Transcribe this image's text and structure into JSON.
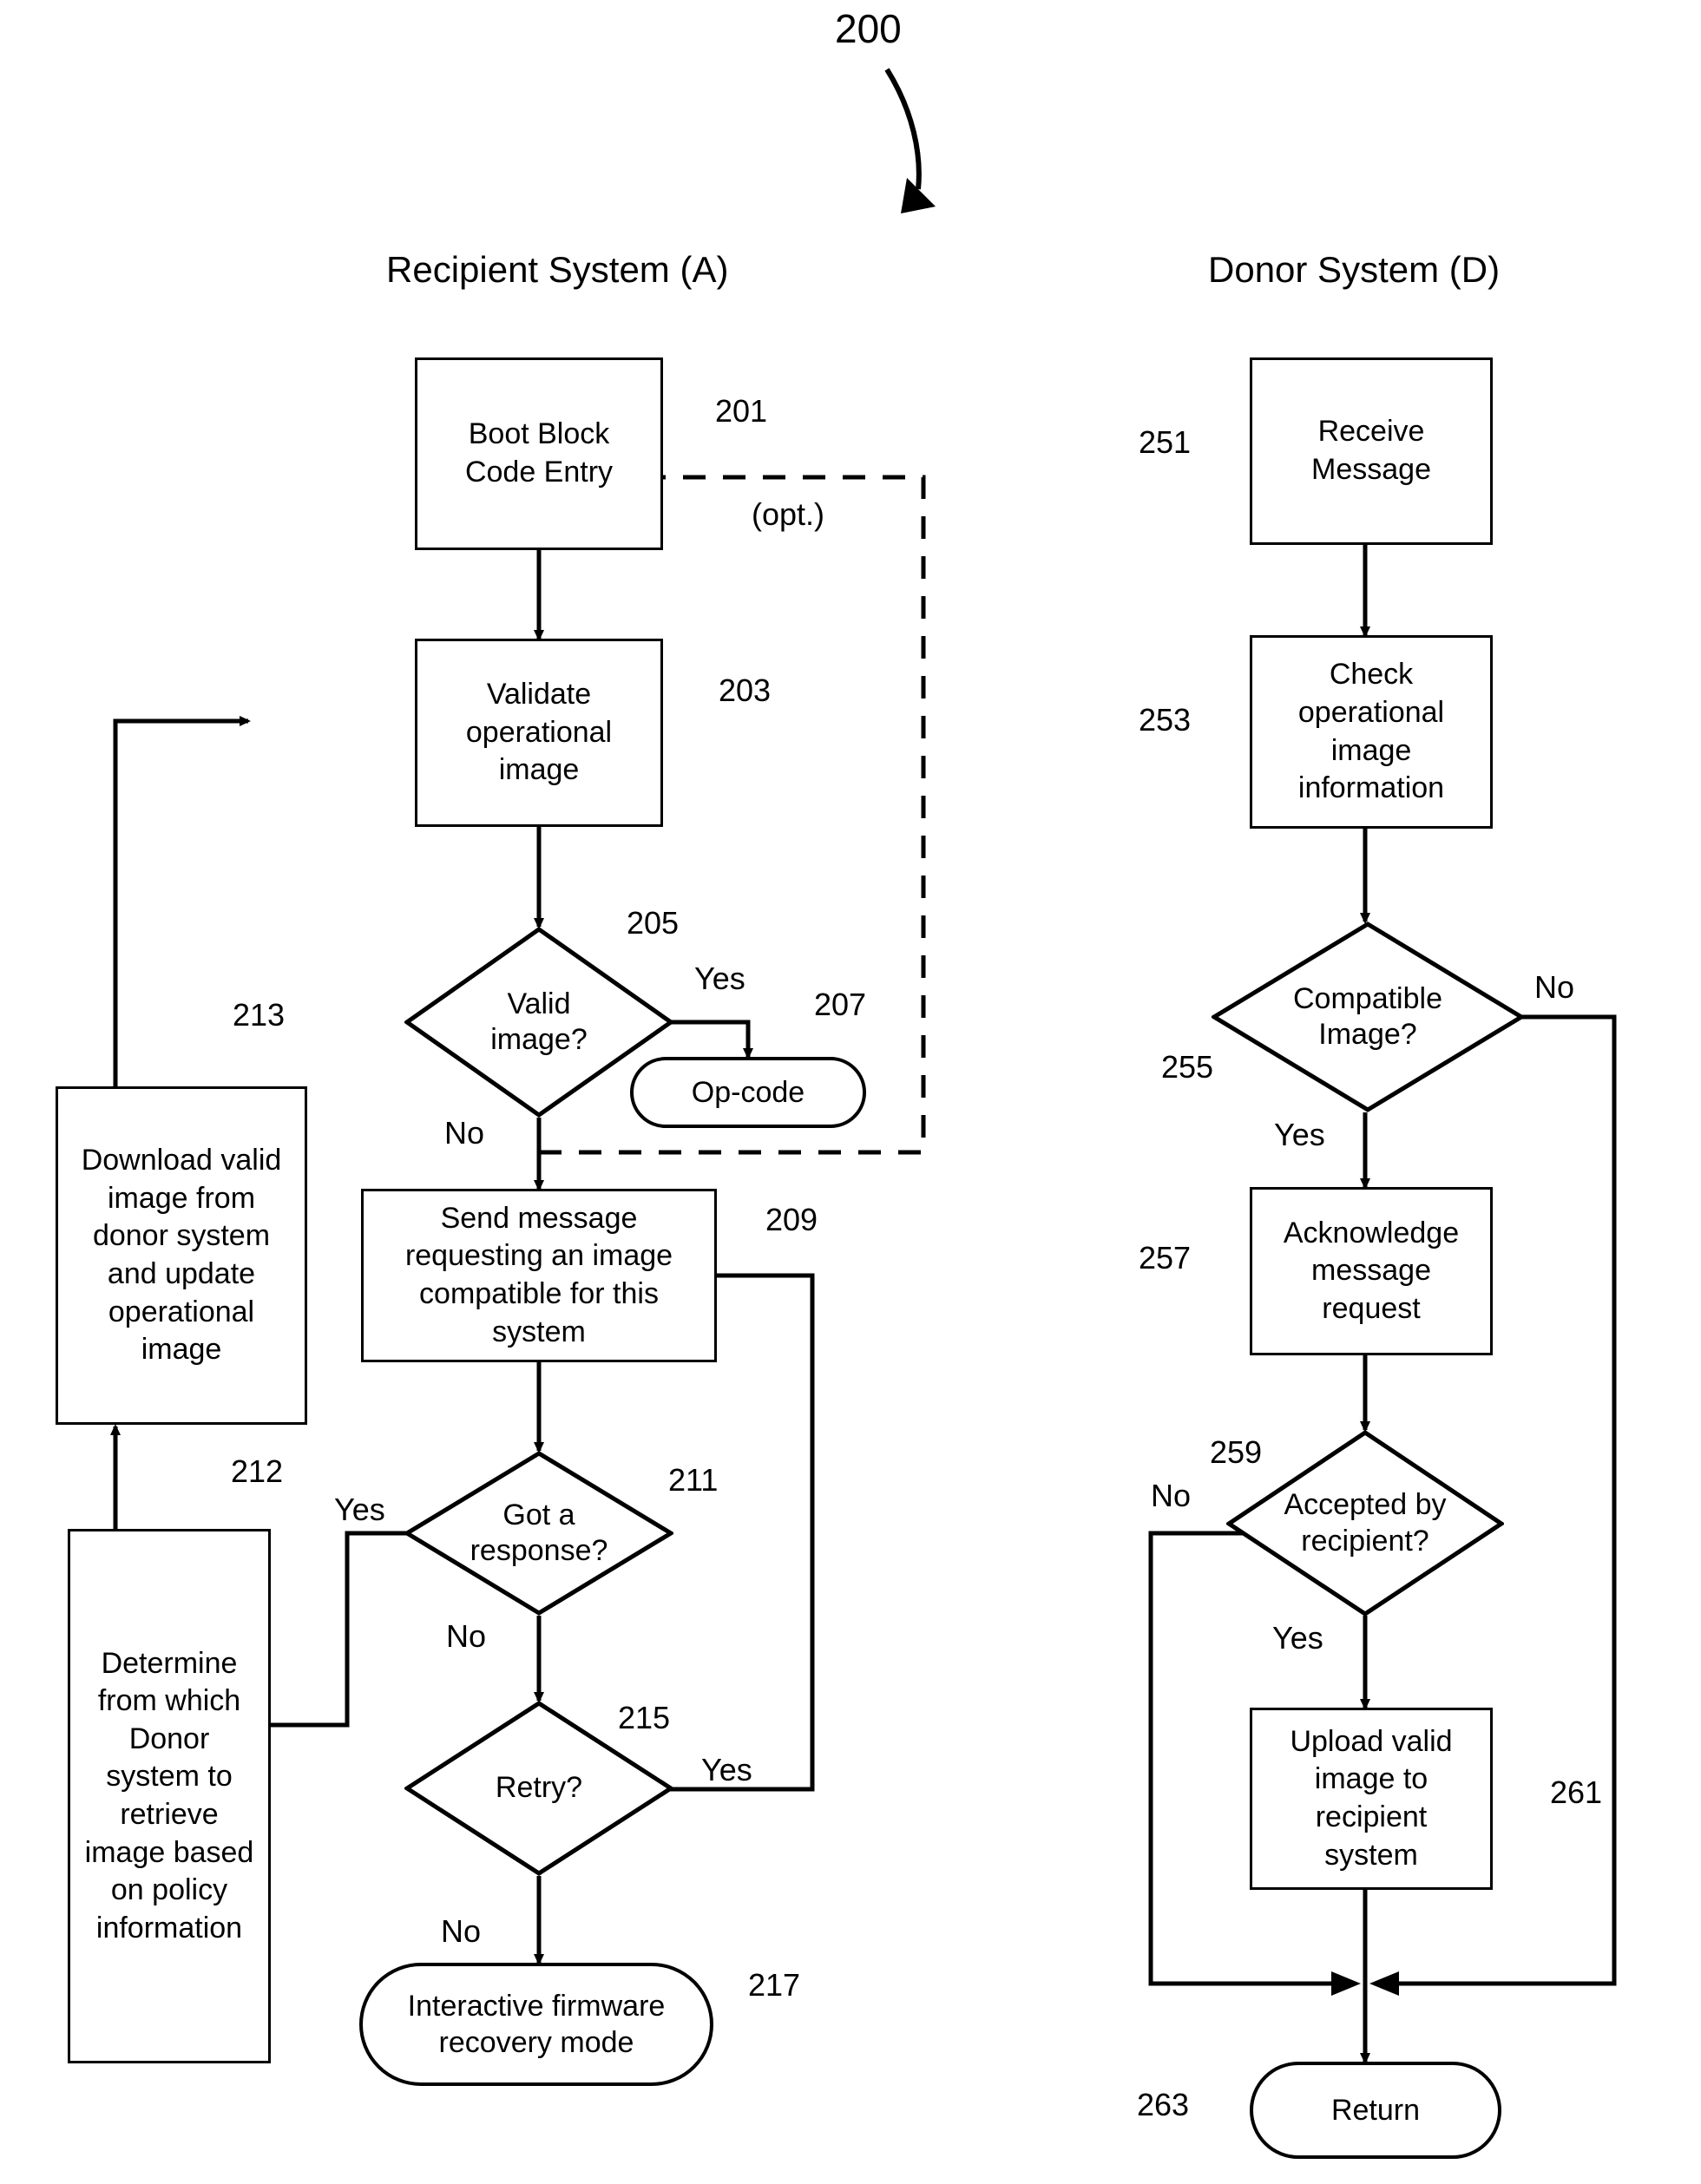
{
  "figure": {
    "number": "200",
    "columns": [
      {
        "id": "recipient",
        "title": "Recipient System (A)"
      },
      {
        "id": "donor",
        "title": "Donor System (D)"
      }
    ]
  },
  "recipient": {
    "nodes": [
      {
        "ref": "201",
        "shape": "process",
        "text": "Boot Block\nCode Entry"
      },
      {
        "ref": "203",
        "shape": "process",
        "text": "Validate\noperational\nimage"
      },
      {
        "ref": "205",
        "shape": "decision",
        "text": "Valid\nimage?"
      },
      {
        "ref": "207",
        "shape": "terminal",
        "text": "Op-code"
      },
      {
        "ref": "209",
        "shape": "process",
        "text": "Send message\nrequesting an image\ncompatible for this\nsystem"
      },
      {
        "ref": "211",
        "shape": "decision",
        "text": "Got a\nresponse?"
      },
      {
        "ref": "212",
        "shape": "process",
        "text": "Determine\nfrom which\nDonor\nsystem to\nretrieve\nimage based\non policy\ninformation"
      },
      {
        "ref": "213",
        "shape": "process",
        "text": "Download valid\nimage from\ndonor system\nand update\noperational\nimage"
      },
      {
        "ref": "215",
        "shape": "decision",
        "text": "Retry?"
      },
      {
        "ref": "217",
        "shape": "terminal",
        "text": "Interactive firmware\nrecovery mode"
      }
    ],
    "edge_labels": {
      "valid_yes": "Yes",
      "valid_no": "No",
      "optional": "(opt.)",
      "response_yes": "Yes",
      "response_no": "No",
      "retry_yes": "Yes",
      "retry_no": "No"
    }
  },
  "donor": {
    "nodes": [
      {
        "ref": "251",
        "shape": "process",
        "text": "Receive\nMessage"
      },
      {
        "ref": "253",
        "shape": "process",
        "text": "Check\noperational\nimage\ninformation"
      },
      {
        "ref": "255",
        "shape": "decision",
        "text": "Compatible\nImage?"
      },
      {
        "ref": "257",
        "shape": "process",
        "text": "Acknowledge\nmessage\nrequest"
      },
      {
        "ref": "259",
        "shape": "decision",
        "text": "Accepted by\nrecipient?"
      },
      {
        "ref": "261",
        "shape": "process",
        "text": "Upload valid\nimage to\nrecipient\nsystem"
      },
      {
        "ref": "263",
        "shape": "terminal",
        "text": "Return"
      }
    ],
    "edge_labels": {
      "compatible_no": "No",
      "compatible_yes": "Yes",
      "accepted_no": "No",
      "accepted_yes": "Yes"
    }
  },
  "colors": {
    "ink": "#000000",
    "paper": "#ffffff"
  }
}
